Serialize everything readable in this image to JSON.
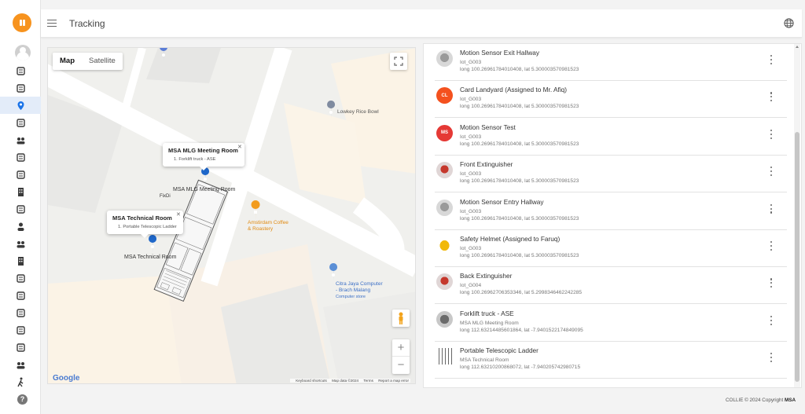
{
  "app": {
    "page_title": "Tracking"
  },
  "rail": {
    "icons": [
      "database-icon",
      "dashboard-icon",
      "location-pin-icon",
      "floorplan-icon",
      "group-icon",
      "layers-icon",
      "library-icon",
      "building-icon",
      "boat-icon",
      "person-icon",
      "org-chart-icon",
      "apartment-icon",
      "tag-icon",
      "sync-person-icon",
      "person-edit-icon",
      "person-add-icon",
      "person-clock-icon",
      "groups-icon",
      "walk-icon",
      "more-icon"
    ],
    "active_index": 2
  },
  "map": {
    "toggle": {
      "map": "Map",
      "satellite": "Satellite",
      "selected": "map"
    },
    "places": {
      "lowkey": "Lowkey Rice Bowl",
      "coffee_line1": "Amstirdam Coffee",
      "coffee_line2": "& Roastery",
      "citra_line1": "Citra Jaya Computer",
      "citra_line2": "- Brach Malang",
      "citra_category": "Computer store",
      "fixdi": "FixDi",
      "room_meeting": "MSA MLG Meeting Room",
      "room_technical": "MSA Technical Room"
    },
    "popup_meeting": {
      "title": "MSA MLG Meeting Room",
      "line": "1.  Forklift truck - ASE"
    },
    "popup_technical": {
      "title": "MSA Technical Room",
      "line": "1.  Portable Telescopic Ladder"
    },
    "google": "Google",
    "attribution": {
      "shortcuts": "Keyboard shortcuts",
      "data": "Map data ©2024",
      "terms": "Terms",
      "report": "Report a map error"
    }
  },
  "devices": [
    {
      "title": "Motion Sensor Exit Hallway",
      "sub": "Iot_G003",
      "coord": "long 100.26961784010408, lat 5.300003570981523",
      "avatar": "photo",
      "initials": ""
    },
    {
      "title": "Card Landyard (Assigned to Mr. Afiq)",
      "sub": "Iot_G003",
      "coord": "long 100.26961784010408, lat 5.300003570981523",
      "avatar": "initials",
      "initials": "CL"
    },
    {
      "title": "Motion Sensor Test",
      "sub": "Iot_G003",
      "coord": "long 100.26961784010408, lat 5.300003570981523",
      "avatar": "initials-red",
      "initials": "MS"
    },
    {
      "title": "Front Extinguisher",
      "sub": "Iot_G003",
      "coord": "long 100.26961784010408, lat 5.300003570981523",
      "avatar": "photo-red",
      "initials": ""
    },
    {
      "title": "Motion Sensor Entry Hallway",
      "sub": "Iot_G003",
      "coord": "long 100.26961784010408, lat 5.300003570981523",
      "avatar": "photo",
      "initials": ""
    },
    {
      "title": "Safety Helmet (Assigned to Faruq)",
      "sub": "Iot_G003",
      "coord": "long 100.26961784010408, lat 5.300003570981523",
      "avatar": "photo-helmet",
      "initials": ""
    },
    {
      "title": "Back Extinguisher",
      "sub": "Iot_G004",
      "coord": "long 100.26962706353346, lat 5.2998346462242285",
      "avatar": "photo-red",
      "initials": ""
    },
    {
      "title": "Forklift truck - ASE",
      "sub": "MSA MLG Meeting Room",
      "coord": "long 112.63214485601864, lat -7.9401522174849095",
      "avatar": "photo-truck",
      "initials": ""
    },
    {
      "title": "Portable Telescopic Ladder",
      "sub": "MSA Technical Room",
      "coord": "long 112.63210200868072, lat -7.940205742980715",
      "avatar": "photo-ladder",
      "initials": ""
    }
  ],
  "colors": {
    "brand": "#f7931e",
    "initials_cl": "#f4511e",
    "initials_ms": "#e53935",
    "active_rail": "#1a73e8"
  },
  "footer": {
    "text": "COLLIE © 2024 Copyright",
    "brand": "MSA"
  }
}
